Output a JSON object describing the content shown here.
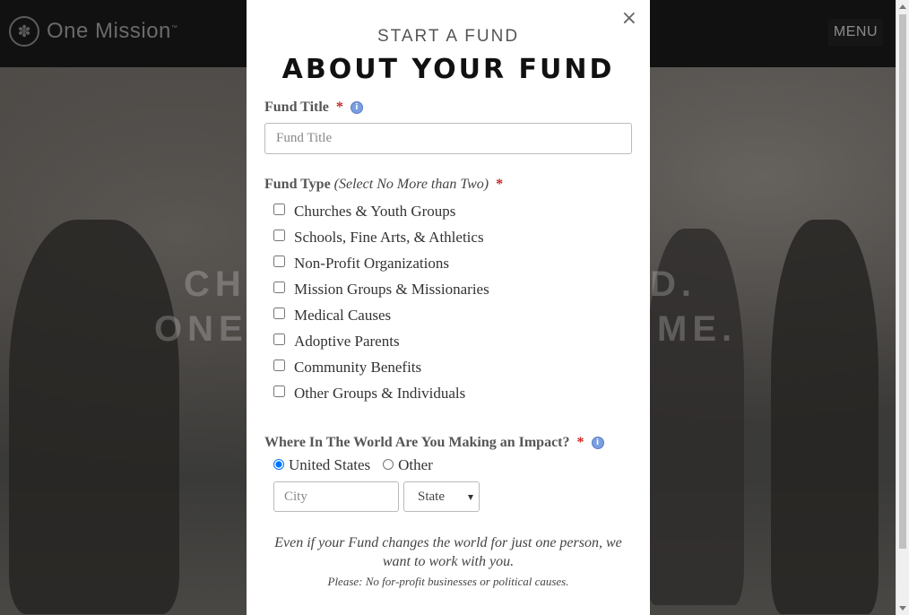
{
  "site": {
    "brand": "One Mission",
    "brand_mark": "™",
    "menu_label": "MENU",
    "hero_line1_left": "CH",
    "hero_line1_right": "D.",
    "hero_line2_left": "ONE",
    "hero_line2_right": "ME."
  },
  "modal": {
    "close_label": "×",
    "kicker": "START A FUND",
    "heading": "ABOUT YOUR FUND",
    "fund_title": {
      "label": "Fund Title",
      "required": "*",
      "info": "i",
      "placeholder": "Fund Title",
      "value": ""
    },
    "fund_type": {
      "label": "Fund Type",
      "hint": "(Select No More than Two)",
      "required": "*",
      "options": [
        "Churches & Youth Groups",
        "Schools, Fine Arts, & Athletics",
        "Non-Profit Organizations",
        "Mission Groups & Missionaries",
        "Medical Causes",
        "Adoptive Parents",
        "Community Benefits",
        "Other Groups & Individuals"
      ]
    },
    "location": {
      "label": "Where In The World Are You Making an Impact?",
      "required": "*",
      "info": "i",
      "radio_options": [
        "United States",
        "Other"
      ],
      "selected": "United States",
      "city_placeholder": "City",
      "state_label": "State"
    },
    "note": "Even if your Fund changes the world for just one person, we want to work with you.",
    "subnote": "Please: No for-profit businesses or political causes."
  }
}
